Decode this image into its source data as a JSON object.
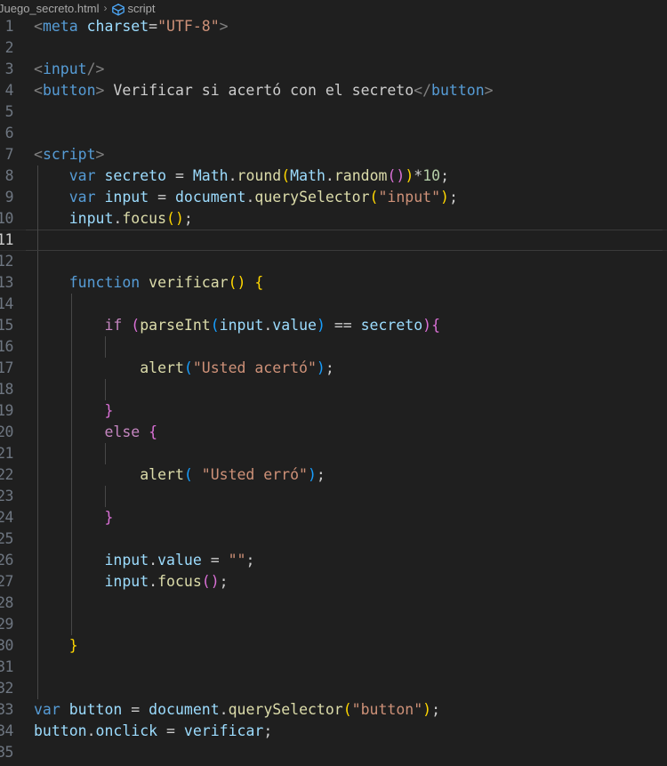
{
  "window": {
    "background": "#1f1f1f",
    "app": "code-editor"
  },
  "breadcrumb": {
    "file": "Juego_secreto.html",
    "separator": "›",
    "symbol_icon": "cube-icon",
    "symbol": "script"
  },
  "editor": {
    "active_line": 11,
    "first_line": 1,
    "total_lines_visible": 35,
    "colors": {
      "background": "#1f1f1f",
      "line_number": "#6e7681",
      "active_line_number": "#cccccc",
      "indent_guide": "#474747",
      "keyword": "#569cd6",
      "control": "#c586c0",
      "function": "#dcdcaa",
      "variable": "#9cdcfe",
      "string": "#ce9178",
      "number": "#b5cea8",
      "punctuation": "#808080",
      "text": "#cccccc",
      "bracket1": "#ffd700",
      "bracket2": "#da70d6",
      "bracket3": "#179fff"
    },
    "lines": [
      {
        "n": 1,
        "text": "    <meta charset=\"UTF-8\">"
      },
      {
        "n": 2,
        "text": ""
      },
      {
        "n": 3,
        "text": "    <input/>"
      },
      {
        "n": 4,
        "text": "    <button> Verificar si acertó con el secreto</button>"
      },
      {
        "n": 5,
        "text": ""
      },
      {
        "n": 6,
        "text": ""
      },
      {
        "n": 7,
        "text": "    <script>"
      },
      {
        "n": 8,
        "text": "        var secreto = Math.round(Math.random())*10;"
      },
      {
        "n": 9,
        "text": "        var input = document.querySelector(\"input\");"
      },
      {
        "n": 10,
        "text": "        input.focus();"
      },
      {
        "n": 11,
        "text": ""
      },
      {
        "n": 12,
        "text": ""
      },
      {
        "n": 13,
        "text": "        function verificar() {"
      },
      {
        "n": 14,
        "text": ""
      },
      {
        "n": 15,
        "text": "            if (parseInt(input.value) == secreto){"
      },
      {
        "n": 16,
        "text": ""
      },
      {
        "n": 17,
        "text": "                alert(\"Usted acertó\");"
      },
      {
        "n": 18,
        "text": ""
      },
      {
        "n": 19,
        "text": "            }"
      },
      {
        "n": 20,
        "text": "            else {"
      },
      {
        "n": 21,
        "text": ""
      },
      {
        "n": 22,
        "text": "                alert( \"Usted erró\");"
      },
      {
        "n": 23,
        "text": ""
      },
      {
        "n": 24,
        "text": "            }"
      },
      {
        "n": 25,
        "text": ""
      },
      {
        "n": 26,
        "text": "            input.value = \"\";"
      },
      {
        "n": 27,
        "text": "            input.focus();"
      },
      {
        "n": 28,
        "text": ""
      },
      {
        "n": 29,
        "text": ""
      },
      {
        "n": 30,
        "text": "        }"
      },
      {
        "n": 31,
        "text": ""
      },
      {
        "n": 32,
        "text": ""
      },
      {
        "n": 33,
        "text": "    var button = document.querySelector(\"button\");"
      },
      {
        "n": 34,
        "text": "    button.onclick = verificar;"
      },
      {
        "n": 35,
        "text": ""
      }
    ]
  }
}
